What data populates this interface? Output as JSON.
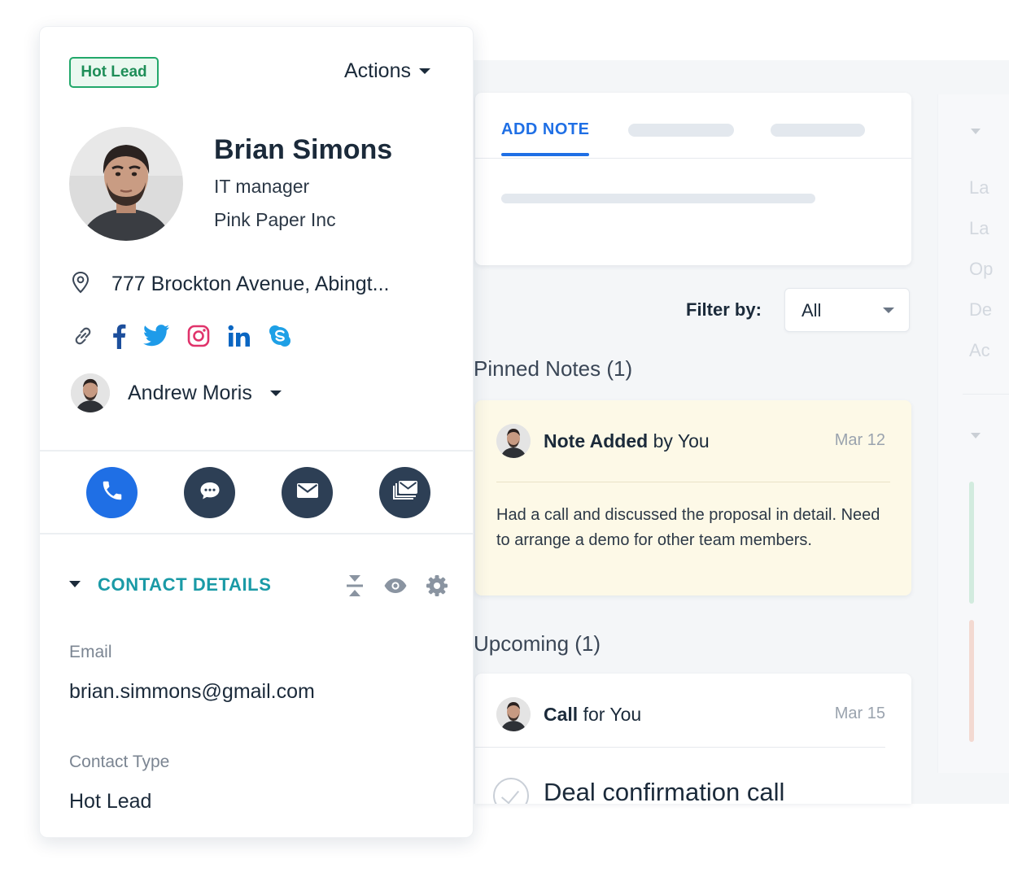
{
  "contact": {
    "badge": "Hot Lead",
    "actions_label": "Actions",
    "name": "Brian Simons",
    "role": "IT manager",
    "company": "Pink Paper Inc",
    "address": "777 Brockton Avenue, Abingt...",
    "social_icons": [
      "link-icon",
      "facebook-icon",
      "twitter-icon",
      "instagram-icon",
      "linkedin-icon",
      "skype-icon"
    ],
    "owner": "Andrew Moris",
    "comm_buttons": [
      "phone-icon",
      "chat-icon",
      "email-icon",
      "bulk-email-icon"
    ],
    "details": {
      "title": "CONTACT DETAILS",
      "tool_icons": [
        "collapse-icon",
        "eye-icon",
        "gear-icon"
      ],
      "fields": [
        {
          "label": "Email",
          "value": "brian.simmons@gmail.com"
        },
        {
          "label": "Contact Type",
          "value": "Hot Lead"
        }
      ]
    }
  },
  "notes": {
    "active_tab": "ADD NOTE",
    "filter_label": "Filter by:",
    "filter_value": "All",
    "pinned_heading": "Pinned Notes (1)",
    "pinned_note": {
      "title_bold": "Note Added",
      "title_rest": " by You",
      "date": "Mar 12",
      "body": "Had a call and discussed the proposal in detail. Need to arrange a demo for other team members."
    },
    "upcoming_heading": "Upcoming (1)",
    "upcoming_item": {
      "title_bold": "Call",
      "title_rest": " for You",
      "date": "Mar 15",
      "task": "Deal confirmation call"
    }
  },
  "side_panel": {
    "faded_labels": [
      "La",
      "La",
      "Op",
      "De",
      "Ac"
    ]
  },
  "colors": {
    "primary_blue": "#1f6fe5",
    "badge_green": "#22a86b",
    "details_teal": "#1a9aa6",
    "dark_button": "#2d3f55",
    "pinned_note_bg": "#fdf9e7"
  }
}
